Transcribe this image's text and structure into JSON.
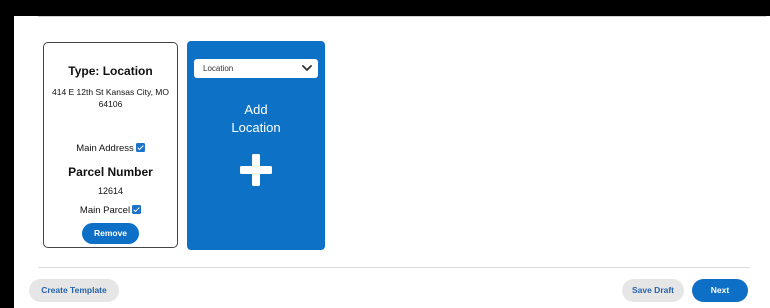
{
  "location_card": {
    "type_label": "Type: Location",
    "address": "414 E 12th St Kansas City, MO 64106",
    "main_address_label": "Main Address",
    "main_address_checked": true,
    "parcel_title": "Parcel Number",
    "parcel_value": "12614",
    "main_parcel_label": "Main Parcel",
    "main_parcel_checked": true,
    "remove_label": "Remove"
  },
  "add_panel": {
    "select_value": "Location",
    "add_label_line1": "Add",
    "add_label_line2": "Location",
    "icon": "plus-icon"
  },
  "footer": {
    "create_template_label": "Create Template",
    "save_draft_label": "Save Draft",
    "next_label": "Next"
  },
  "colors": {
    "accent": "#0d72c6",
    "secondary_button_bg": "#e6e6e6",
    "secondary_button_text": "#2563a8"
  }
}
